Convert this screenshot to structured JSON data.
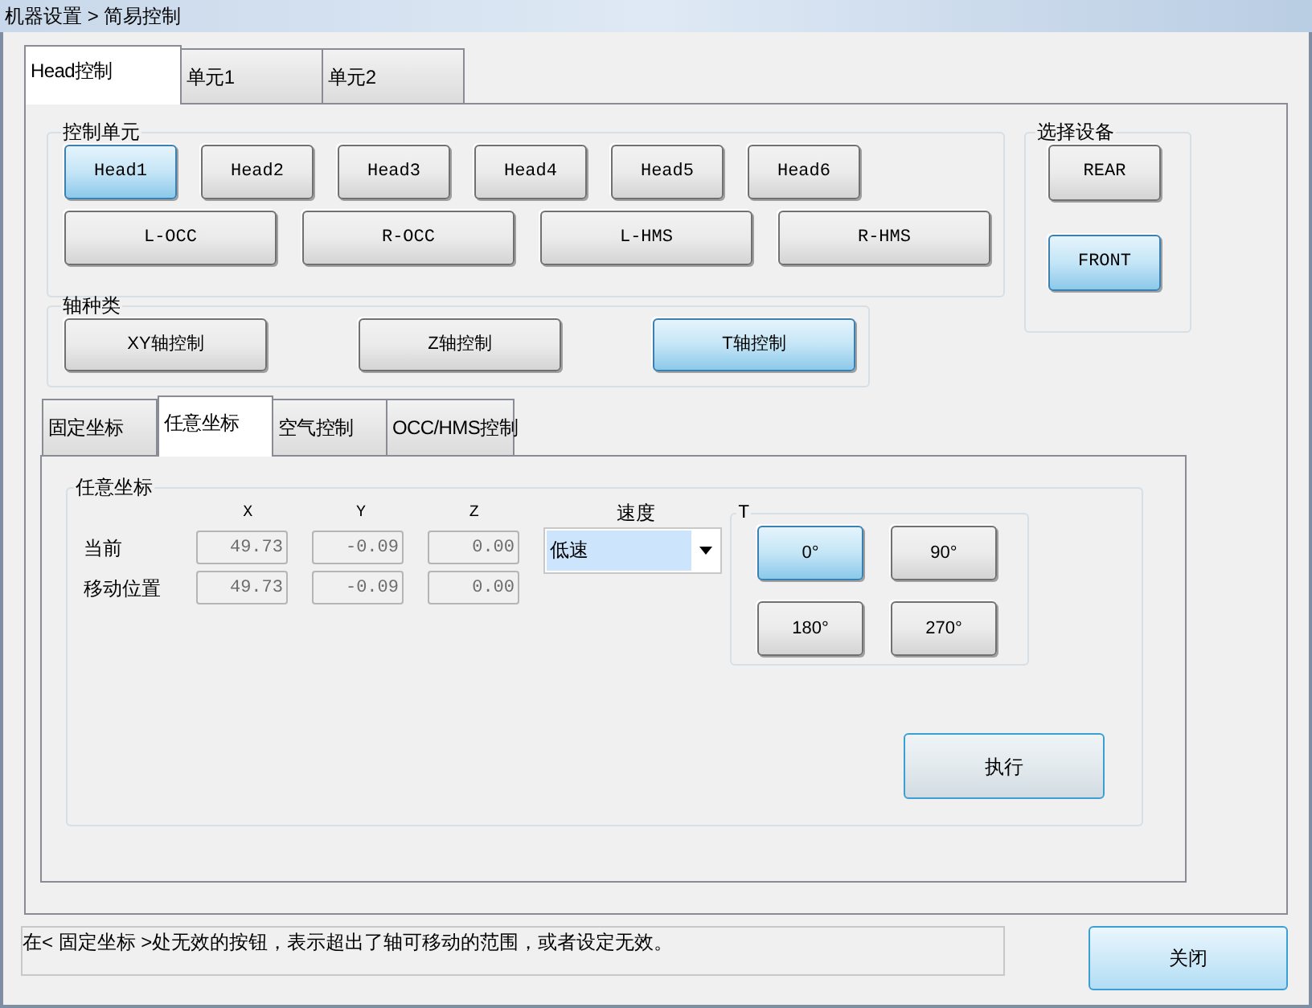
{
  "window": {
    "title": "机器设置 > 简易控制"
  },
  "tabs": [
    {
      "label": "Head控制",
      "selected": true
    },
    {
      "label": "单元1",
      "selected": false
    },
    {
      "label": "单元2",
      "selected": false
    }
  ],
  "control_unit": {
    "title": "控制单元",
    "heads": [
      {
        "label": "Head1",
        "selected": true
      },
      {
        "label": "Head2",
        "selected": false
      },
      {
        "label": "Head3",
        "selected": false
      },
      {
        "label": "Head4",
        "selected": false
      },
      {
        "label": "Head5",
        "selected": false
      },
      {
        "label": "Head6",
        "selected": false
      }
    ],
    "units": [
      {
        "label": "L-OCC",
        "selected": false
      },
      {
        "label": "R-OCC",
        "selected": false
      },
      {
        "label": "L-HMS",
        "selected": false
      },
      {
        "label": "R-HMS",
        "selected": false
      }
    ]
  },
  "device": {
    "title": "选择设备",
    "buttons": [
      {
        "label": "REAR",
        "selected": false
      },
      {
        "label": "FRONT",
        "selected": true
      }
    ]
  },
  "axis_type": {
    "title": "轴种类",
    "buttons": [
      {
        "label": "XY轴控制",
        "selected": false
      },
      {
        "label": "Z轴控制",
        "selected": false
      },
      {
        "label": "T轴控制",
        "selected": true
      }
    ]
  },
  "sub_tabs": [
    {
      "label": "固定坐标",
      "selected": false
    },
    {
      "label": "任意坐标",
      "selected": true
    },
    {
      "label": "空气控制",
      "selected": false
    },
    {
      "label": "OCC/HMS控制",
      "selected": false
    }
  ],
  "panel": {
    "title": "任意坐标",
    "columns": [
      "X",
      "Y",
      "Z"
    ],
    "rows": [
      {
        "label": "当前",
        "disabled": true,
        "values": [
          "49.73",
          "-0.09",
          "0.00"
        ]
      },
      {
        "label": "移动位置",
        "disabled": true,
        "values": [
          "49.73",
          "-0.09",
          "0.00"
        ]
      }
    ],
    "speed": {
      "label": "速度",
      "value": "低速"
    },
    "t_group": {
      "title": "T",
      "buttons": [
        {
          "label": "0°",
          "selected": true
        },
        {
          "label": "90°",
          "selected": false
        },
        {
          "label": "180°",
          "selected": false
        },
        {
          "label": "270°",
          "selected": false
        }
      ]
    },
    "execute_button": "执行"
  },
  "status_message": "在< 固定坐标 >处无效的按钮，表示超出了轴可移动的范围，或者设定无效。",
  "close_button": "关闭"
}
